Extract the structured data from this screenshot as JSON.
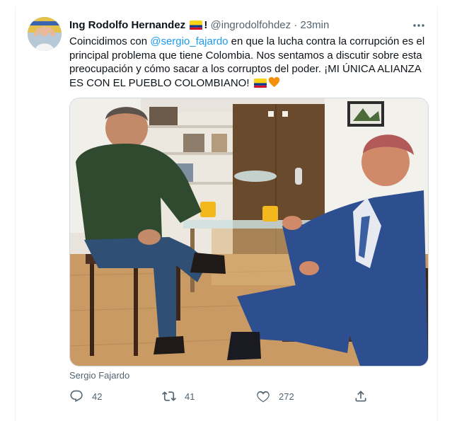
{
  "author": {
    "name": "Ing Rodolfo Hernandez",
    "exclamation": "!",
    "handle": "@ingrodolfohdez",
    "separator": "·",
    "time": "23min"
  },
  "tweet": {
    "text_before": "Coincidimos con ",
    "mention": "@sergio_fajardo",
    "text_after": " en que la lucha contra la corrupción es el principal problema que tiene Colombia. Nos sentamos a discutir sobre esta preocupación y cómo sacar a los corruptos del poder. ¡MI ÚNICA ALIANZA ES CON EL PUEBLO COLOMBIANO! "
  },
  "media": {
    "caption": "Sergio Fajardo"
  },
  "actions": {
    "reply_count": "42",
    "retweet_count": "41",
    "like_count": "272"
  },
  "icons": {
    "reply": "reply-icon",
    "retweet": "retweet-icon",
    "like": "heart-icon",
    "share": "share-icon",
    "more": "more-icon"
  },
  "colors": {
    "accent": "#1d9bf0",
    "secondary_text": "#536471",
    "heart": "#f4900c"
  }
}
